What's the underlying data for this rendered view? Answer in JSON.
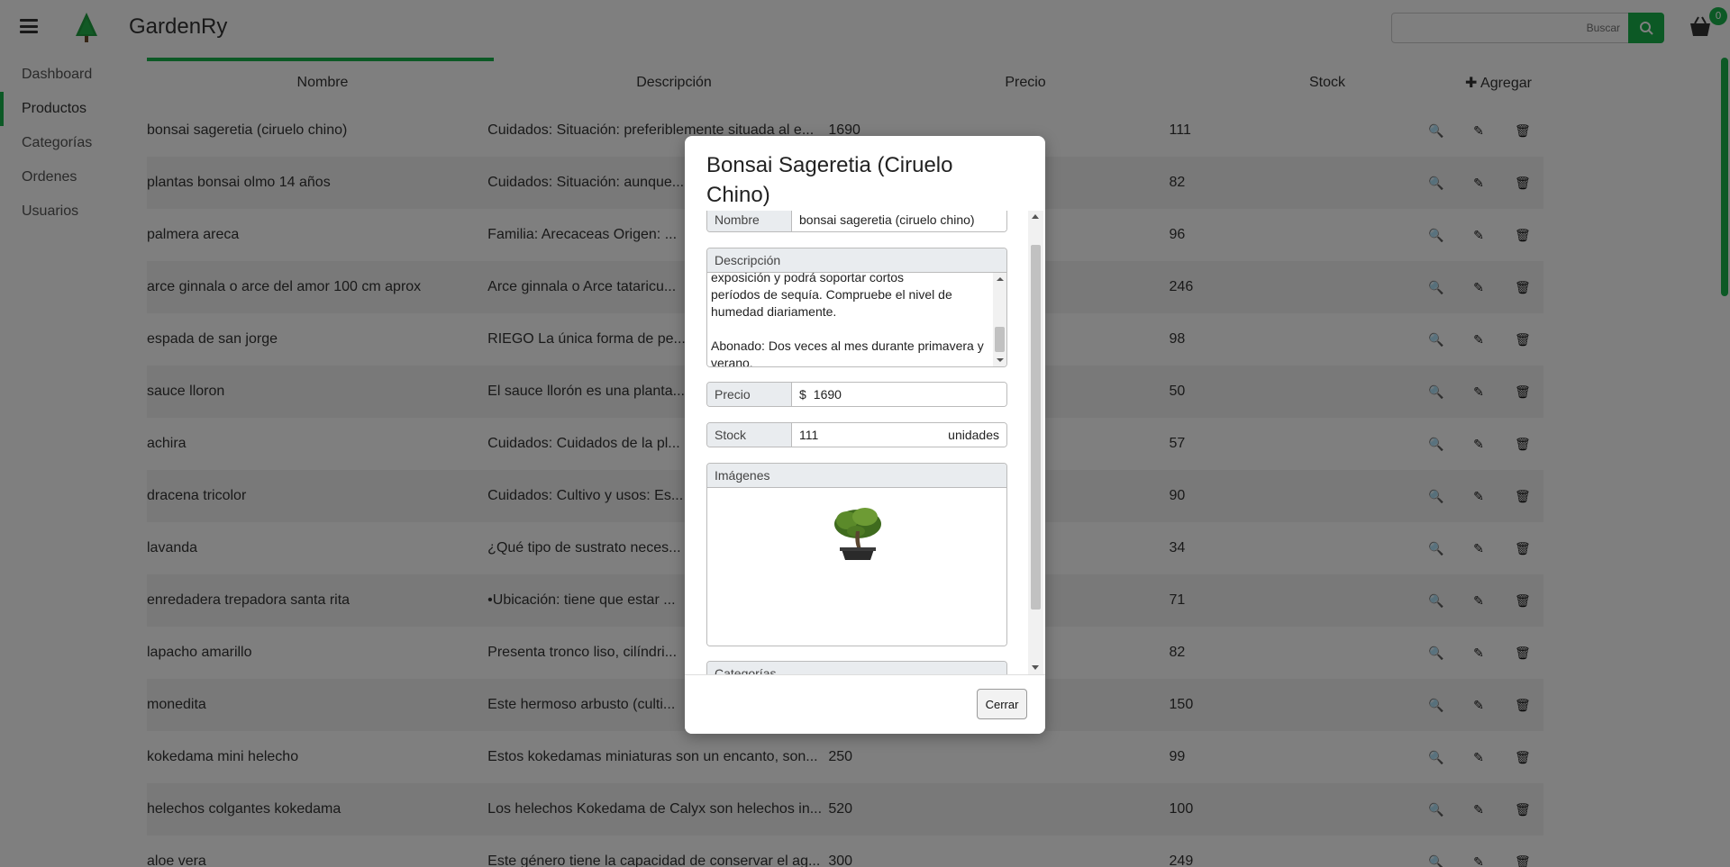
{
  "app": {
    "brand": "GardenRy"
  },
  "search": {
    "placeholder": "Buscar"
  },
  "cart": {
    "badge": "0"
  },
  "sidebar": {
    "items": [
      {
        "label": "Dashboard"
      },
      {
        "label": "Productos"
      },
      {
        "label": "Categorías"
      },
      {
        "label": "Ordenes"
      },
      {
        "label": "Usuarios"
      }
    ]
  },
  "table": {
    "headers": {
      "name": "Nombre",
      "description": "Descripción",
      "price": "Precio",
      "stock": "Stock",
      "add": "Agregar"
    },
    "rows": [
      {
        "name": "bonsai sageretia (ciruelo chino)",
        "description": "Cuidados: Situación: preferiblemente situada al e...",
        "price": "1690",
        "stock": "111"
      },
      {
        "name": "plantas bonsai olmo 14 años",
        "description": "Cuidados: Situación: aunque...",
        "price": "",
        "stock": "82"
      },
      {
        "name": "palmera areca",
        "description": "Familia: Arecaceas Origen: ...",
        "price": "",
        "stock": "96"
      },
      {
        "name": "arce ginnala o arce del amor 100 cm aprox",
        "description": "Arce ginnala o Arce tataricu...",
        "price": "",
        "stock": "246"
      },
      {
        "name": "espada de san jorge",
        "description": "RIEGO La única forma de pe...",
        "price": "",
        "stock": "98"
      },
      {
        "name": "sauce lloron",
        "description": "El sauce llorón es una planta...",
        "price": "",
        "stock": "50"
      },
      {
        "name": "achira",
        "description": "Cuidados: Cuidados de la pl...",
        "price": "",
        "stock": "57"
      },
      {
        "name": "dracena tricolor",
        "description": "Cuidados: Cultivo y usos: Es...",
        "price": "",
        "stock": "90"
      },
      {
        "name": "lavanda",
        "description": "¿Qué tipo de sustrato neces...",
        "price": "",
        "stock": "34"
      },
      {
        "name": "enredadera trepadora santa rita",
        "description": "•Ubicación: tiene que estar ...",
        "price": "",
        "stock": "71"
      },
      {
        "name": "lapacho amarillo",
        "description": "Presenta tronco liso, cilíndri...",
        "price": "",
        "stock": "82"
      },
      {
        "name": "monedita",
        "description": "Este hermoso arbusto (culti...",
        "price": "",
        "stock": "150"
      },
      {
        "name": "kokedama mini helecho",
        "description": "Estos kokedamas miniaturas son un encanto, son...",
        "price": "250",
        "stock": "99"
      },
      {
        "name": "helechos colgantes kokedama",
        "description": "Los helechos Kokedama de Calyx son helechos in...",
        "price": "520",
        "stock": "100"
      },
      {
        "name": "aloe vera",
        "description": "Este género tiene la capacidad de conservar el ag...",
        "price": "300",
        "stock": "249"
      }
    ]
  },
  "modal": {
    "title": "Bonsai Sageretia (Ciruelo Chino)",
    "name_label": "Nombre",
    "name_value": "bonsai sageretia (ciruelo chino)",
    "description_label": "Descripción",
    "description_text": "exposición y podrá soportar cortos\nperíodos de sequía. Compruebe el nivel de\nhumedad diariamente.\n\nAbonado: Dos veces al mes durante primavera y\nverano.",
    "price_label": "Precio",
    "price_currency": "$",
    "price_value": "1690",
    "stock_label": "Stock",
    "stock_value": "111",
    "stock_unit": "unidades",
    "images_label": "Imágenes",
    "categories_label": "Categorías",
    "close_label": "Cerrar"
  },
  "colors": {
    "accent": "#19b34a",
    "overlay": "rgba(0,0,0,0.5)"
  }
}
